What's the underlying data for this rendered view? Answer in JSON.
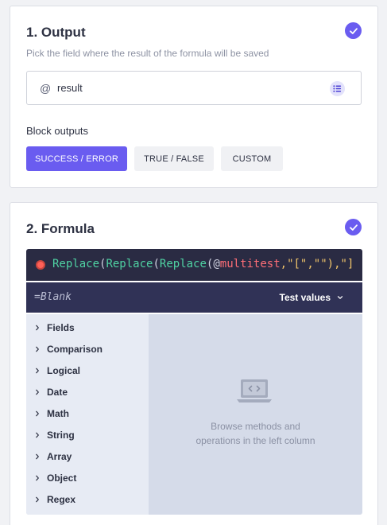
{
  "output_section": {
    "title": "1. Output",
    "subtitle": "Pick the field where the result of the formula will be saved",
    "field": {
      "prefix": "@",
      "value": "result"
    },
    "block_outputs_label": "Block outputs",
    "buttons": [
      {
        "label": "SUCCESS / ERROR",
        "active": true
      },
      {
        "label": "TRUE / FALSE",
        "active": false
      },
      {
        "label": "CUSTOM",
        "active": false
      }
    ]
  },
  "formula_section": {
    "title": "2. Formula",
    "code": {
      "fn1": "Replace",
      "p1": "(",
      "fn2": "Replace",
      "p2": "(",
      "fn3": "Replace",
      "p3": "(@",
      "var": "multitest",
      "str1": ",\"[\",\"\"),\"]",
      "tail": ""
    },
    "blank": "=Blank",
    "test_values_label": "Test values",
    "categories": [
      "Fields",
      "Comparison",
      "Logical",
      "Date",
      "Math",
      "String",
      "Array",
      "Object",
      "Regex"
    ],
    "empty_message_line1": "Browse methods and",
    "empty_message_line2": "operations in the left column"
  },
  "colors": {
    "accent": "#6a5cf0",
    "editor_bg": "#2a2b43",
    "function": "#4fd3a3",
    "variable": "#ff6e77",
    "string": "#f0c46a"
  },
  "icons": {
    "check": "check-circle-icon",
    "list": "list-icon",
    "chevron": "chevron-right-icon",
    "laptop": "laptop-code-icon",
    "test_dropdown": "chevron-down-icon"
  }
}
